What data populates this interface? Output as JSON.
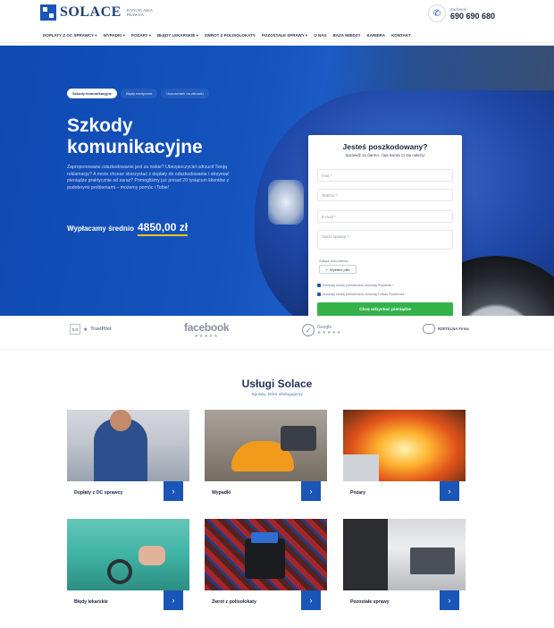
{
  "header": {
    "logo_text": "SOLACE",
    "logo_sub_line1": "KANCELARIA",
    "logo_sub_line2": "PRAWNA",
    "phone_label": "Zadzwoń",
    "phone_number": "690 690 680"
  },
  "nav": {
    "items": [
      "DOPŁATY Z OC SPRAWCY ▾",
      "WYPADKI ▾",
      "POŻARY ▾",
      "BŁĘDY LEKARSKIE ▾",
      "ZWROT Z POLISOLOKATY",
      "POZOSTAŁE SPRAWY ▾",
      "O NAS",
      "BAZA WIEDZY",
      "KARIERA",
      "KONTAKT"
    ]
  },
  "hero": {
    "tabs": [
      "Szkody komunikacyjne",
      "Błędy medyczne",
      "Uszczerbek na zdrowiu"
    ],
    "title_line1": "Szkody",
    "title_line2": "komunikacyjne",
    "text": "Zaproponowane odszkodowanie jest za niskie? Ubezpieczyciel odrzucił Twoją reklamację? A może chcesz skorzystać z dopłaty do odszkodowania i otrzymać pieniądze praktycznie od zaraz? Pomogliśmy już ponad 20 tysiącom klientów z podobnymi problemami – możemy pomóc i Tobie!",
    "avg_label": "Wypłacamy średnio",
    "avg_amount": "4850,00 zł"
  },
  "form": {
    "title": "Jesteś poszkodowany?",
    "subtitle": "Sprawdź za darmo, claa kwota Ci się należy!",
    "fields": [
      {
        "placeholder": "Imię *"
      },
      {
        "placeholder": "Telefon *"
      },
      {
        "placeholder": "E-mail *"
      },
      {
        "placeholder": "Opisz sprawę *"
      }
    ],
    "attach_label": "Załącz dokumenty",
    "attach_button": "Wybierz pliki",
    "consent_1": "Akceptuję zasady przetwarzania, akceptuję Regulamin *",
    "consent_2": "Akceptuję zasady przetwarzania, akceptuję Politykę Prywatności *",
    "submit": "Chcę odzyskać pieniądze"
  },
  "trust": {
    "trustpilot_score": "5.0",
    "trustpilot_name": "TrustPilot",
    "facebook_name": "facebook",
    "facebook_stars": "★★★★★",
    "google_name": "Google",
    "google_stars": "★★★★★",
    "rzetelna_name": "RZETELNA Firma"
  },
  "services": {
    "title": "Usługi Solace",
    "subtitle": "Sprawy, które obsługujemy",
    "cards": [
      {
        "label": "Dopłaty z OC sprawcy"
      },
      {
        "label": "Wypadki"
      },
      {
        "label": "Pożary"
      },
      {
        "label": "Błędy lekarskie"
      },
      {
        "label": "Zwrot z polisolokaty"
      },
      {
        "label": "Pozostałe sprawy"
      }
    ]
  },
  "icons": {
    "phone": "phone-icon",
    "arrow": "chevron-right-icon",
    "upload": "upload-icon",
    "check": "check-icon"
  },
  "colors": {
    "brand_blue": "#1a55b8",
    "cta_green": "#34b24a",
    "accent_yellow": "#f0c419"
  }
}
